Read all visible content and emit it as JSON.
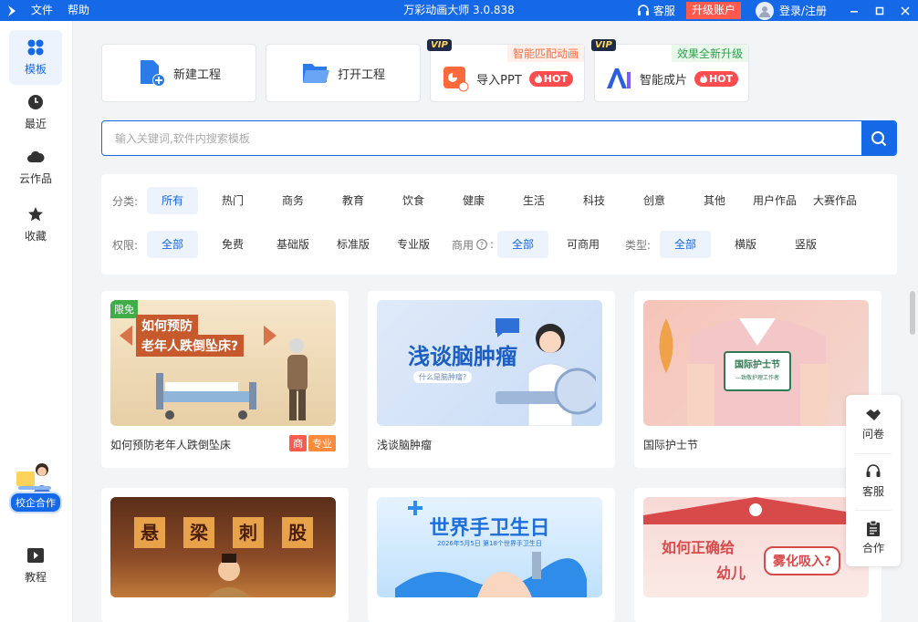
{
  "titlebar": {
    "menu_file": "文件",
    "menu_help": "帮助",
    "title": "万彩动画大师 3.0.838",
    "service": "客服",
    "upgrade": "升级账户",
    "login": "登录/注册",
    "color": "#1669e6"
  },
  "sidebar": {
    "items": [
      {
        "label": "模板",
        "icon": "grid-icon"
      },
      {
        "label": "最近",
        "icon": "clock-icon"
      },
      {
        "label": "云作品",
        "icon": "cloud-icon"
      },
      {
        "label": "收藏",
        "icon": "star-icon"
      }
    ],
    "coop_label": "校企合作",
    "tutorial_label": "教程"
  },
  "actions": {
    "new_project": "新建工程",
    "open_project": "打开工程",
    "import_ppt": "导入PPT",
    "smart_video": "智能成片",
    "vip": "VIP",
    "hot": "HOT",
    "ppt_tag": "智能匹配动画",
    "smart_tag": "效果全新升级"
  },
  "search": {
    "placeholder": "输入关键词,软件内搜索模板"
  },
  "filters": {
    "category_label": "分类:",
    "categories": [
      "所有",
      "热门",
      "商务",
      "教育",
      "饮食",
      "健康",
      "生活",
      "科技",
      "创意",
      "其他",
      "用户作品",
      "大赛作品"
    ],
    "permission_label": "权限:",
    "permissions": [
      "全部",
      "免费",
      "基础版",
      "标准版",
      "专业版"
    ],
    "commercial_label": "商用",
    "commercial_colon": ":",
    "commercial": [
      "全部",
      "可商用"
    ],
    "type_label": "类型:",
    "types": [
      "全部",
      "横版",
      "竖版"
    ]
  },
  "templates": [
    {
      "title": "如何预防老年人跌倒坠床",
      "thumb_text_1": "如何预防",
      "thumb_text_2": "老年人跌倒坠床?",
      "corner": "限免",
      "badges": [
        "商",
        "专业"
      ]
    },
    {
      "title": "浅谈脑肿瘤",
      "thumb_text_1": "浅谈脑肿瘤",
      "thumb_text_2": "什么是脑肿瘤?"
    },
    {
      "title": "国际护士节",
      "thumb_text_1": "国际护士节",
      "thumb_text_2": "—致敬护理工作者"
    },
    {
      "title": "",
      "thumb_text_1": "悬",
      "thumb_text_2": "梁",
      "thumb_text_3": "刺",
      "thumb_text_4": "股"
    },
    {
      "title": "",
      "thumb_text_1": "世界手卫生日",
      "thumb_text_2": "2026年5月5日    第18个世界手卫生日"
    },
    {
      "title": "",
      "thumb_text_1": "如何正确给",
      "thumb_text_2": "幼儿",
      "thumb_text_3": "雾化吸入?"
    }
  ],
  "float_panel": {
    "survey": "问卷",
    "service": "客服",
    "cooperation": "合作"
  }
}
